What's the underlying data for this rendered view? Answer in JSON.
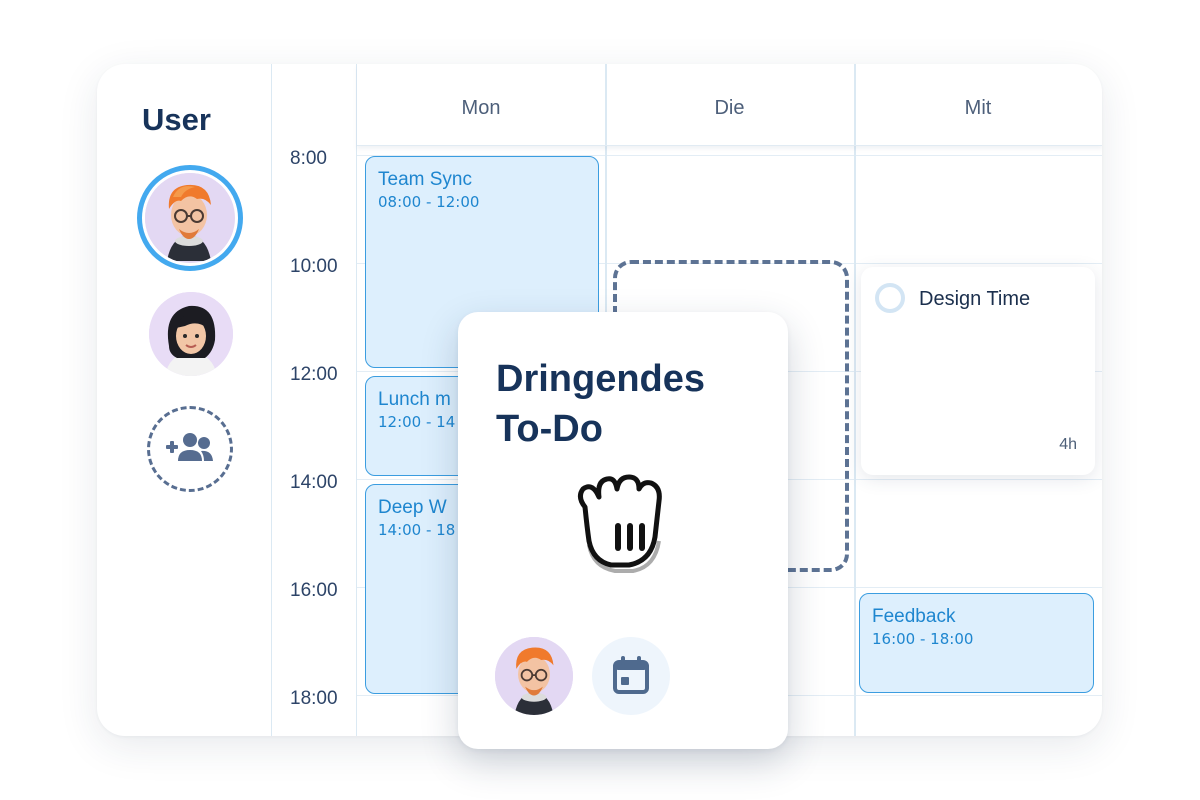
{
  "sidebar": {
    "title": "User",
    "users": [
      {
        "name": "user-avatar-1",
        "selected": true
      },
      {
        "name": "user-avatar-2",
        "selected": false
      }
    ],
    "add_user_icon": "add-user-icon"
  },
  "calendar": {
    "days": [
      "Mon",
      "Die",
      "Mit"
    ],
    "times": [
      "8:00",
      "10:00",
      "12:00",
      "14:00",
      "16:00",
      "18:00"
    ],
    "events": [
      {
        "title": "Team Sync",
        "time": "08:00 - 12:00",
        "day": "Mon"
      },
      {
        "title": "Lunch m",
        "time": "12:00 - 14",
        "day": "Mon"
      },
      {
        "title": "Deep W",
        "time": "14:00 - 18",
        "day": "Mon"
      },
      {
        "title": "Feedback",
        "time": "16:00 - 18:00",
        "day": "Mit"
      }
    ],
    "task": {
      "title": "Design Time",
      "duration": "4h",
      "day": "Mit"
    }
  },
  "drag_card": {
    "title_line1": "Dringendes",
    "title_line2": "To-Do",
    "icons": [
      "grab-hand-icon",
      "calendar-icon"
    ]
  },
  "colors": {
    "accent": "#3b9de0",
    "event_fill": "#ddeffd",
    "dark_text": "#17335a",
    "dashed_outline": "#5d7394"
  }
}
